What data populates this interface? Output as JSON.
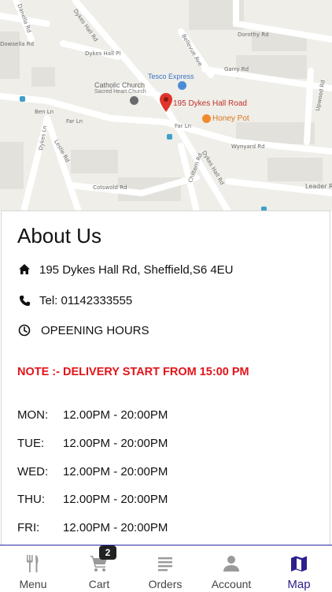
{
  "map": {
    "street_labels": [
      {
        "text": "Dykes Hall Rd",
        "rot": 55
      },
      {
        "text": "Dorothy Rd",
        "rot": 0
      },
      {
        "text": "Bellevue Ave",
        "rot": 60
      },
      {
        "text": "Garry Rd",
        "rot": 0
      },
      {
        "text": "Dykes Hall Pl",
        "rot": 0
      },
      {
        "text": "Ben Ln",
        "rot": 0
      },
      {
        "text": "Far Ln",
        "rot": 0
      },
      {
        "text": "Far Ln",
        "rot": 0
      },
      {
        "text": "Wynyard Rd",
        "rot": 0
      },
      {
        "text": "Dykes Ln",
        "rot": -80
      },
      {
        "text": "Leslie Rd",
        "rot": 60
      },
      {
        "text": "Cotswold Rd",
        "rot": 0
      },
      {
        "text": "Chiltern Rd",
        "rot": -70
      },
      {
        "text": "Dykes Hall Rd",
        "rot": 60
      },
      {
        "text": "Upwood Rd",
        "rot": -80
      },
      {
        "text": "Leader R",
        "rot": 0
      },
      {
        "text": "Danella Rd",
        "rot": 70
      },
      {
        "text": "Dowsella Rd",
        "rot": 0
      }
    ],
    "poi": {
      "tesco": "Tesco Express",
      "church_name": "Catholic Church",
      "church_sub": "Sacred Heart Church",
      "pin_label": "195 Dykes Hall Road",
      "honey_pot": "Honey Pot"
    },
    "colors": {
      "pin": "#e0342b",
      "honey": "#f08a2b",
      "tesco": "#4a8dd6",
      "church": "#6a6a6a"
    }
  },
  "about": {
    "title": "About Us",
    "address": "195 Dykes Hall Rd, Sheffield,S6 4EU",
    "address_icon": "home-icon",
    "phone": "Tel: 01142333555",
    "phone_icon": "phone-icon",
    "opening_hours": "OPEENING HOURS",
    "clock_icon": "clock-icon",
    "note": "NOTE :- DELIVERY START FROM 15:00 PM",
    "note_color": "#e2141a",
    "hours": [
      {
        "day": "MON:",
        "time": "12.00PM - 20:00PM"
      },
      {
        "day": "TUE:",
        "time": "12.00PM - 20:00PM"
      },
      {
        "day": "WED:",
        "time": "12.00PM - 20:00PM"
      },
      {
        "day": "THU:",
        "time": "12.00PM - 20:00PM"
      },
      {
        "day": "FRI:",
        "time": "12.00PM - 20:00PM"
      }
    ]
  },
  "tabs": [
    {
      "label": "Menu",
      "icon": "cutlery-icon",
      "active": false
    },
    {
      "label": "Cart",
      "icon": "cart-icon",
      "active": false,
      "badge": "2"
    },
    {
      "label": "Orders",
      "icon": "orders-list-icon",
      "active": false
    },
    {
      "label": "Account",
      "icon": "person-icon",
      "active": false
    },
    {
      "label": "Map",
      "icon": "map-icon",
      "active": true
    }
  ],
  "accent_color": "#2c1f8e"
}
